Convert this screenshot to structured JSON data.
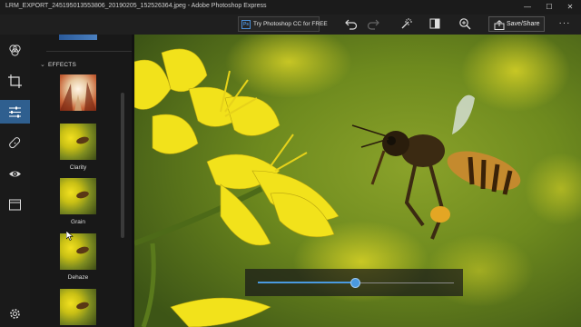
{
  "window": {
    "title": "LRM_EXPORT_245195013553806_20190205_152526364.jpeg - Adobe Photoshop Express",
    "minimize_glyph": "—",
    "maximize_glyph": "☐",
    "close_glyph": "✕"
  },
  "toolbar": {
    "try_label": "Try Photoshop CC for FREE",
    "ps_icon_text": "Ps",
    "save_label": "Save/Share",
    "more_glyph": "···",
    "icons": [
      "undo-icon",
      "redo-icon",
      "magic-wand-icon",
      "compare-icon",
      "zoom-icon",
      "share-icon"
    ]
  },
  "rail": {
    "items": [
      "looks-icon",
      "crop-icon",
      "adjustments-icon",
      "healing-icon",
      "red-eye-icon",
      "frames-icon",
      "settings-icon"
    ],
    "active": "adjustments-icon"
  },
  "panel": {
    "section_title": "EFFECTS",
    "effects": [
      {
        "label": ""
      },
      {
        "label": "Clarity"
      },
      {
        "label": "Grain"
      },
      {
        "label": "Dehaze"
      },
      {
        "label": ""
      }
    ]
  },
  "slider": {
    "value": 0.5
  },
  "colors": {
    "accent": "#4a9ae0",
    "active_rail": "#2f5f8f"
  }
}
